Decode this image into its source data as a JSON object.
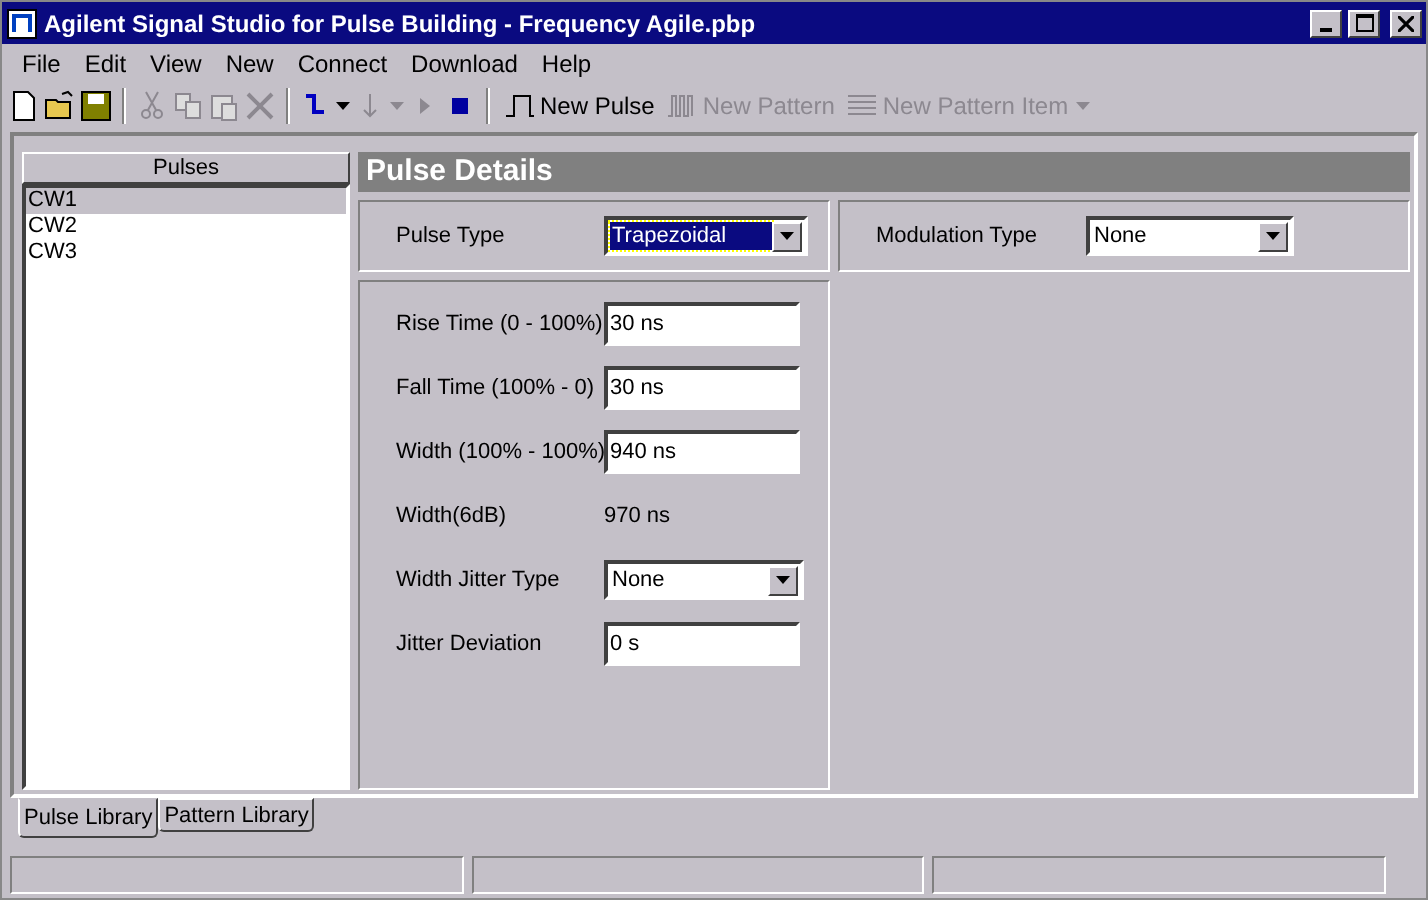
{
  "window": {
    "title": "Agilent Signal Studio for Pulse Building - Frequency Agile.pbp"
  },
  "menu": [
    "File",
    "Edit",
    "View",
    "New",
    "Connect",
    "Download",
    "Help"
  ],
  "toolbar": [
    {
      "label": "New Pulse",
      "disabled": false
    },
    {
      "label": "New Pattern",
      "disabled": true
    },
    {
      "label": "New Pattern Item",
      "disabled": true
    }
  ],
  "pulses": {
    "header": "Pulses",
    "items": [
      {
        "label": "CW1",
        "selected": true
      },
      {
        "label": "CW2",
        "selected": false
      },
      {
        "label": "CW3",
        "selected": false
      }
    ]
  },
  "details": {
    "title": "Pulse Details",
    "pulse_type": {
      "label": "Pulse Type",
      "value": "Trapezoidal",
      "focused": true
    },
    "modulation_type": {
      "label": "Modulation Type",
      "value": "None",
      "focused": false
    },
    "params": [
      {
        "kind": "input",
        "label": "Rise Time (0 - 100%)",
        "value": "30 ns"
      },
      {
        "kind": "input",
        "label": "Fall Time (100% - 0)",
        "value": "30 ns"
      },
      {
        "kind": "input",
        "label": "Width (100% - 100%)",
        "value": "940 ns"
      },
      {
        "kind": "readout",
        "label": "Width(6dB)",
        "value": "970 ns"
      },
      {
        "kind": "select",
        "label": "Width Jitter Type",
        "value": "None"
      },
      {
        "kind": "input",
        "label": "Jitter Deviation",
        "value": "0 s"
      }
    ]
  },
  "tabs": [
    {
      "label": "Pulse Library",
      "selected": true
    },
    {
      "label": "Pattern Library",
      "selected": false
    }
  ]
}
